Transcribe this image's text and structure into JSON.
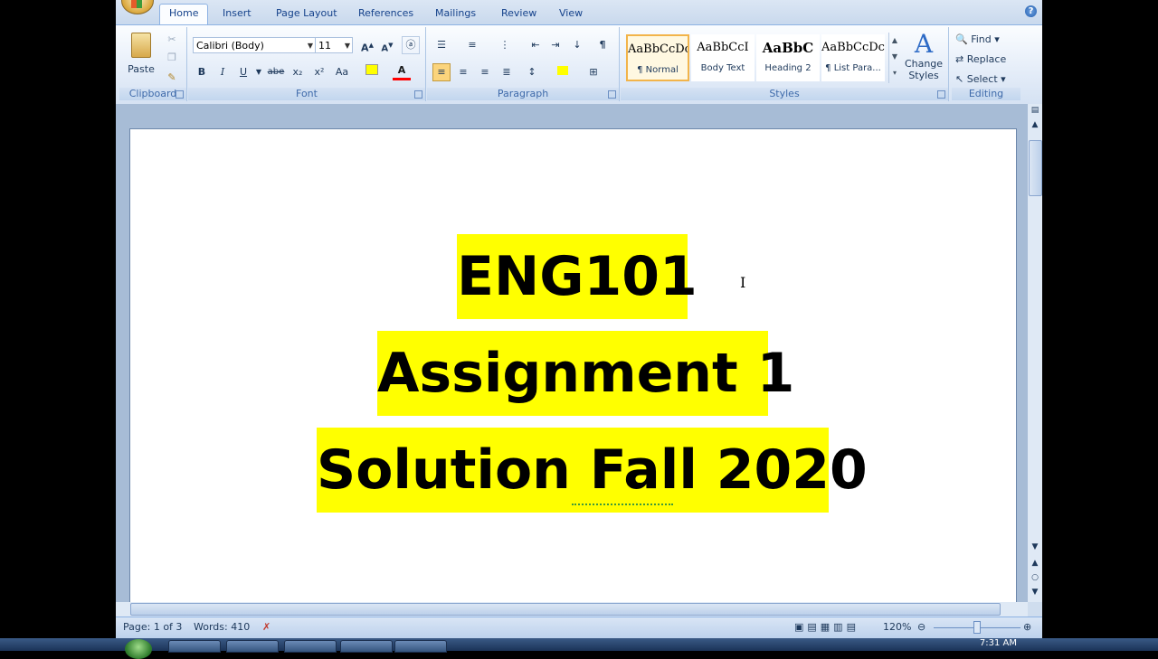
{
  "ribbon_tabs": [
    "Home",
    "Insert",
    "Page Layout",
    "References",
    "Mailings",
    "Review",
    "View"
  ],
  "clipboard": {
    "paste_label": "Paste",
    "group_label": "Clipboard"
  },
  "font": {
    "family": "Calibri (Body)",
    "size": "11",
    "group_label": "Font",
    "bold": "B",
    "italic": "I",
    "underline": "U",
    "strike": "abe",
    "subscript": "x₂",
    "superscript": "x²",
    "change_case": "Aa"
  },
  "paragraph": {
    "group_label": "Paragraph",
    "pilcrow": "¶"
  },
  "styles": {
    "group_label": "Styles",
    "items": [
      {
        "sample": "AaBbCcDc",
        "name": "¶ Normal"
      },
      {
        "sample": "AaBbCcI",
        "name": "Body Text"
      },
      {
        "sample": "AaBbC",
        "name": "Heading 2"
      },
      {
        "sample": "AaBbCcDc",
        "name": "¶ List Para..."
      }
    ],
    "change_styles": "Change Styles"
  },
  "editing": {
    "group_label": "Editing",
    "find": "Find",
    "replace": "Replace",
    "select": "Select"
  },
  "document": {
    "lines": [
      "ENG101",
      "Assignment 1",
      "Solution Fall 2020"
    ],
    "highlight_color": "#ffff00"
  },
  "status": {
    "page": "Page: 1 of 3",
    "words": "Words: 410",
    "zoom": "120%"
  },
  "clock": "7:31 AM"
}
